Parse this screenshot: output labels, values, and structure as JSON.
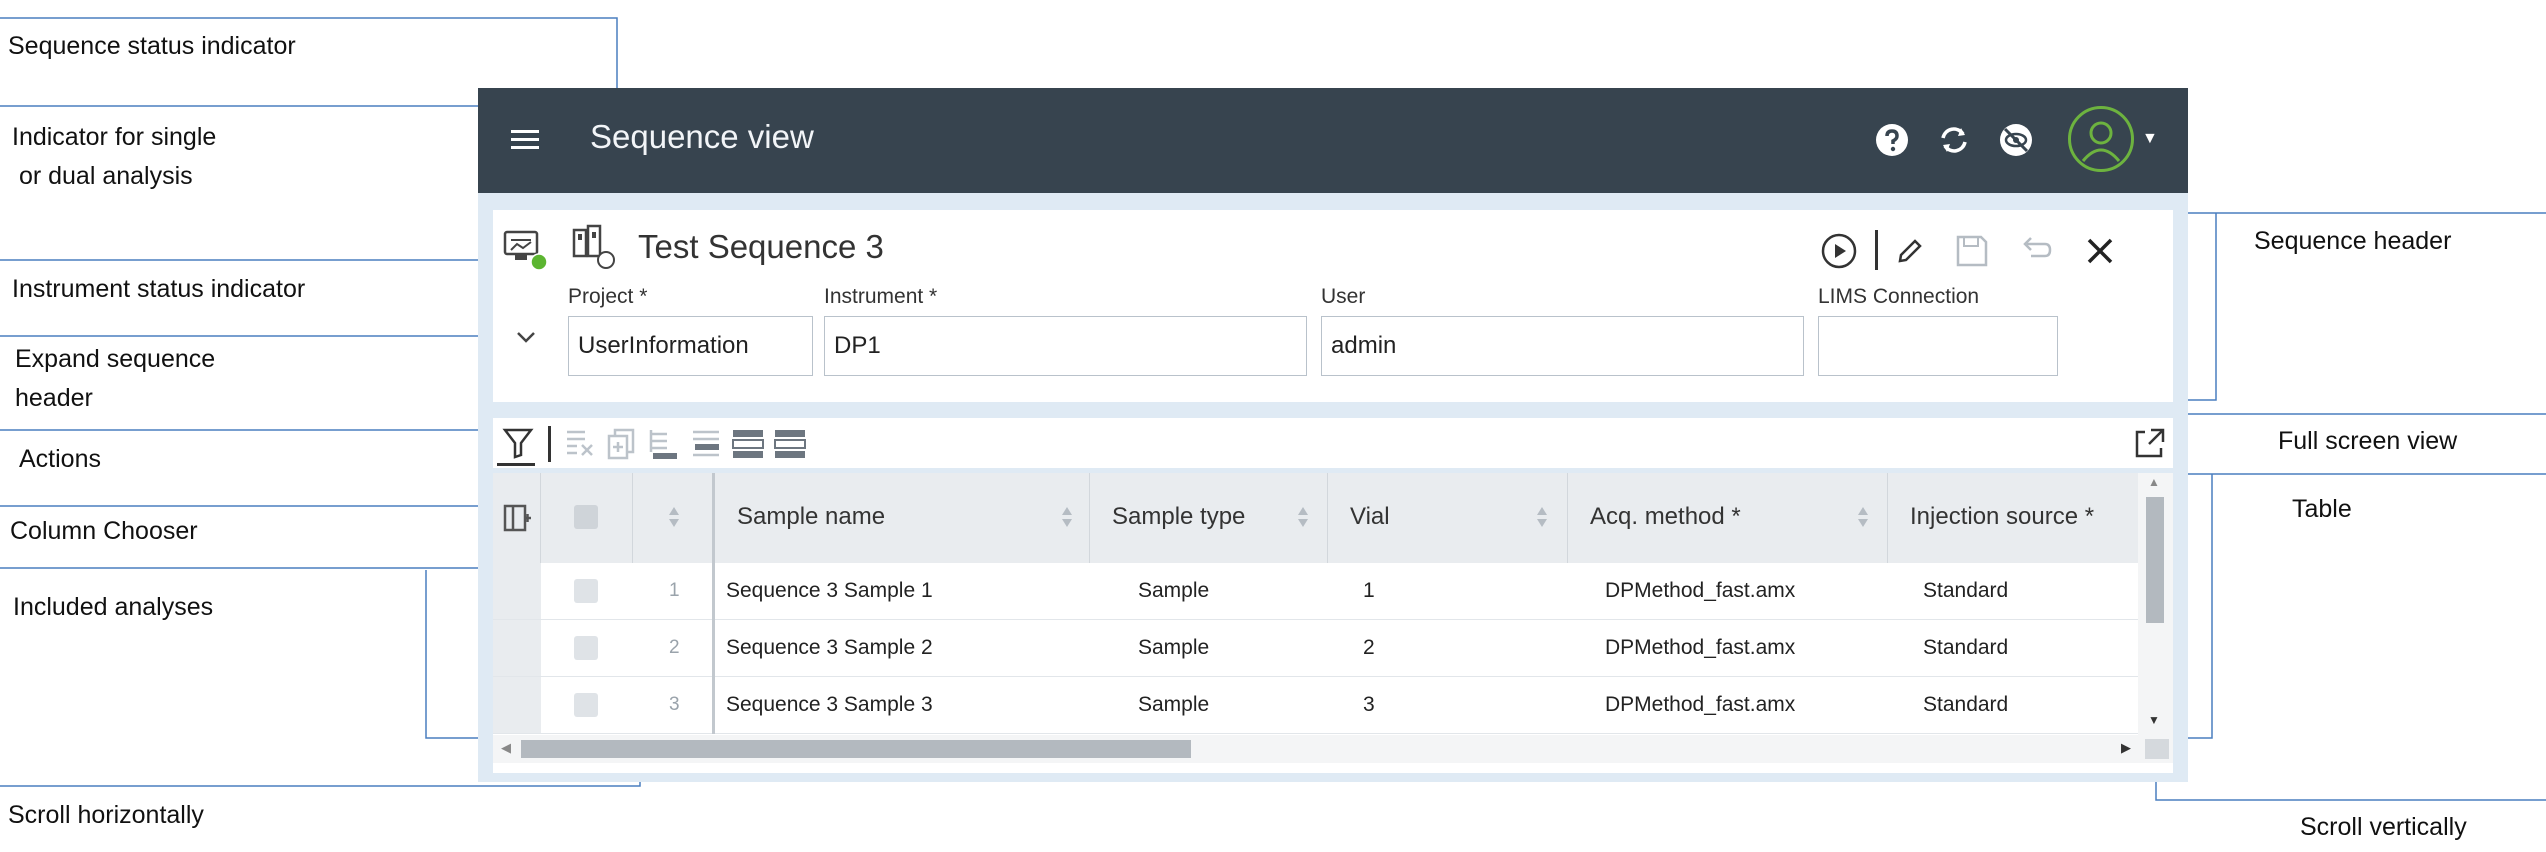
{
  "callouts": {
    "sequence_status": "Sequence status indicator",
    "single_dual_1": "Indicator for single",
    "single_dual_2": " or dual analysis",
    "instrument_status": "Instrument status indicator",
    "expand_1": "Expand sequence",
    "expand_2": "header",
    "actions": "Actions",
    "column_chooser": "Column Chooser",
    "included_analyses": "Included analyses",
    "scroll_horizontally": "Scroll horizontally",
    "sequence_header": "Sequence header",
    "full_screen_view": "Full screen view",
    "table": "Table",
    "scroll_vertically": "Scroll vertically"
  },
  "topbar": {
    "title": "Sequence view"
  },
  "header": {
    "sequence_title": "Test Sequence 3",
    "fields": [
      {
        "label": "Project *",
        "value": "UserInformation"
      },
      {
        "label": "Instrument *",
        "value": "DP1"
      },
      {
        "label": "User",
        "value": "admin"
      },
      {
        "label": "LIMS Connection",
        "value": ""
      }
    ]
  },
  "table": {
    "columns": [
      "Sample name",
      "Sample type",
      "Vial",
      "Acq. method *",
      "Injection source *"
    ],
    "rows": [
      {
        "index": "1",
        "sample_name": "Sequence 3 Sample 1",
        "sample_type": "Sample",
        "vial": "1",
        "acq_method": "DPMethod_fast.amx",
        "injection_source": "Standard"
      },
      {
        "index": "2",
        "sample_name": "Sequence 3 Sample 2",
        "sample_type": "Sample",
        "vial": "2",
        "acq_method": "DPMethod_fast.amx",
        "injection_source": "Standard"
      },
      {
        "index": "3",
        "sample_name": "Sequence 3 Sample 3",
        "sample_type": "Sample",
        "vial": "3",
        "acq_method": "DPMethod_fast.amx",
        "injection_source": "Standard"
      }
    ]
  },
  "colors": {
    "topbar": "#37444f",
    "panel": "#dfeaf4",
    "callout_line": "#4a7ebf",
    "status_green": "#5cb531"
  },
  "icons": [
    "menu-icon",
    "help-icon",
    "refresh-icon",
    "visibility-off-icon",
    "user-avatar-icon",
    "play-icon",
    "edit-icon",
    "save-icon",
    "undo-icon",
    "close-icon",
    "filter-icon",
    "fullscreen-icon",
    "column-chooser-icon"
  ]
}
